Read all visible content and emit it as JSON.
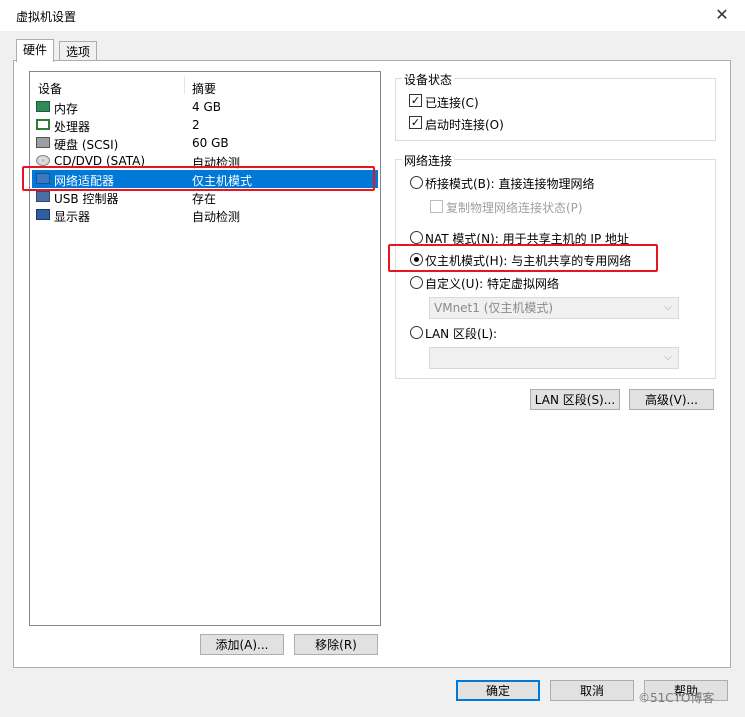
{
  "window": {
    "title": "虚拟机设置",
    "close_glyph": "✕"
  },
  "tabs": [
    {
      "label": "硬件",
      "active": true
    },
    {
      "label": "选项",
      "active": false
    }
  ],
  "devices": {
    "header_device": "设备",
    "header_summary": "摘要",
    "rows": [
      {
        "name": "内存",
        "summary": "4 GB",
        "icon": "memory-icon"
      },
      {
        "name": "处理器",
        "summary": "2",
        "icon": "processor-icon"
      },
      {
        "name": "硬盘 (SCSI)",
        "summary": "60 GB",
        "icon": "hard-disk-icon"
      },
      {
        "name": "CD/DVD (SATA)",
        "summary": "自动检测",
        "icon": "cd-dvd-icon"
      },
      {
        "name": "网络适配器",
        "summary": "仅主机模式",
        "icon": "network-adapter-icon",
        "selected": true
      },
      {
        "name": "USB 控制器",
        "summary": "存在",
        "icon": "usb-icon"
      },
      {
        "name": "显示器",
        "summary": "自动检测",
        "icon": "monitor-icon"
      }
    ]
  },
  "device_buttons": {
    "add": "添加(A)...",
    "remove": "移除(R)"
  },
  "device_status": {
    "title": "设备状态",
    "connected": "已连接(C)",
    "connect_at_power_on": "启动时连接(O)"
  },
  "network": {
    "title": "网络连接",
    "bridged": "桥接模式(B): 直接连接物理网络",
    "replicate": "复制物理网络连接状态(P)",
    "nat": "NAT 模式(N): 用于共享主机的 IP 地址",
    "host_only": "仅主机模式(H): 与主机共享的专用网络",
    "custom": "自定义(U): 特定虚拟网络",
    "custom_value": "VMnet1 (仅主机模式)",
    "lan": "LAN 区段(L):",
    "lan_value": ""
  },
  "network_buttons": {
    "lan_segments": "LAN 区段(S)...",
    "advanced": "高级(V)..."
  },
  "footer": {
    "ok": "确定",
    "cancel": "取消",
    "help": "帮助"
  },
  "watermark": "©51CTO博客",
  "colors": {
    "selection": "#0078d7",
    "highlight_box": "#e8151f"
  }
}
